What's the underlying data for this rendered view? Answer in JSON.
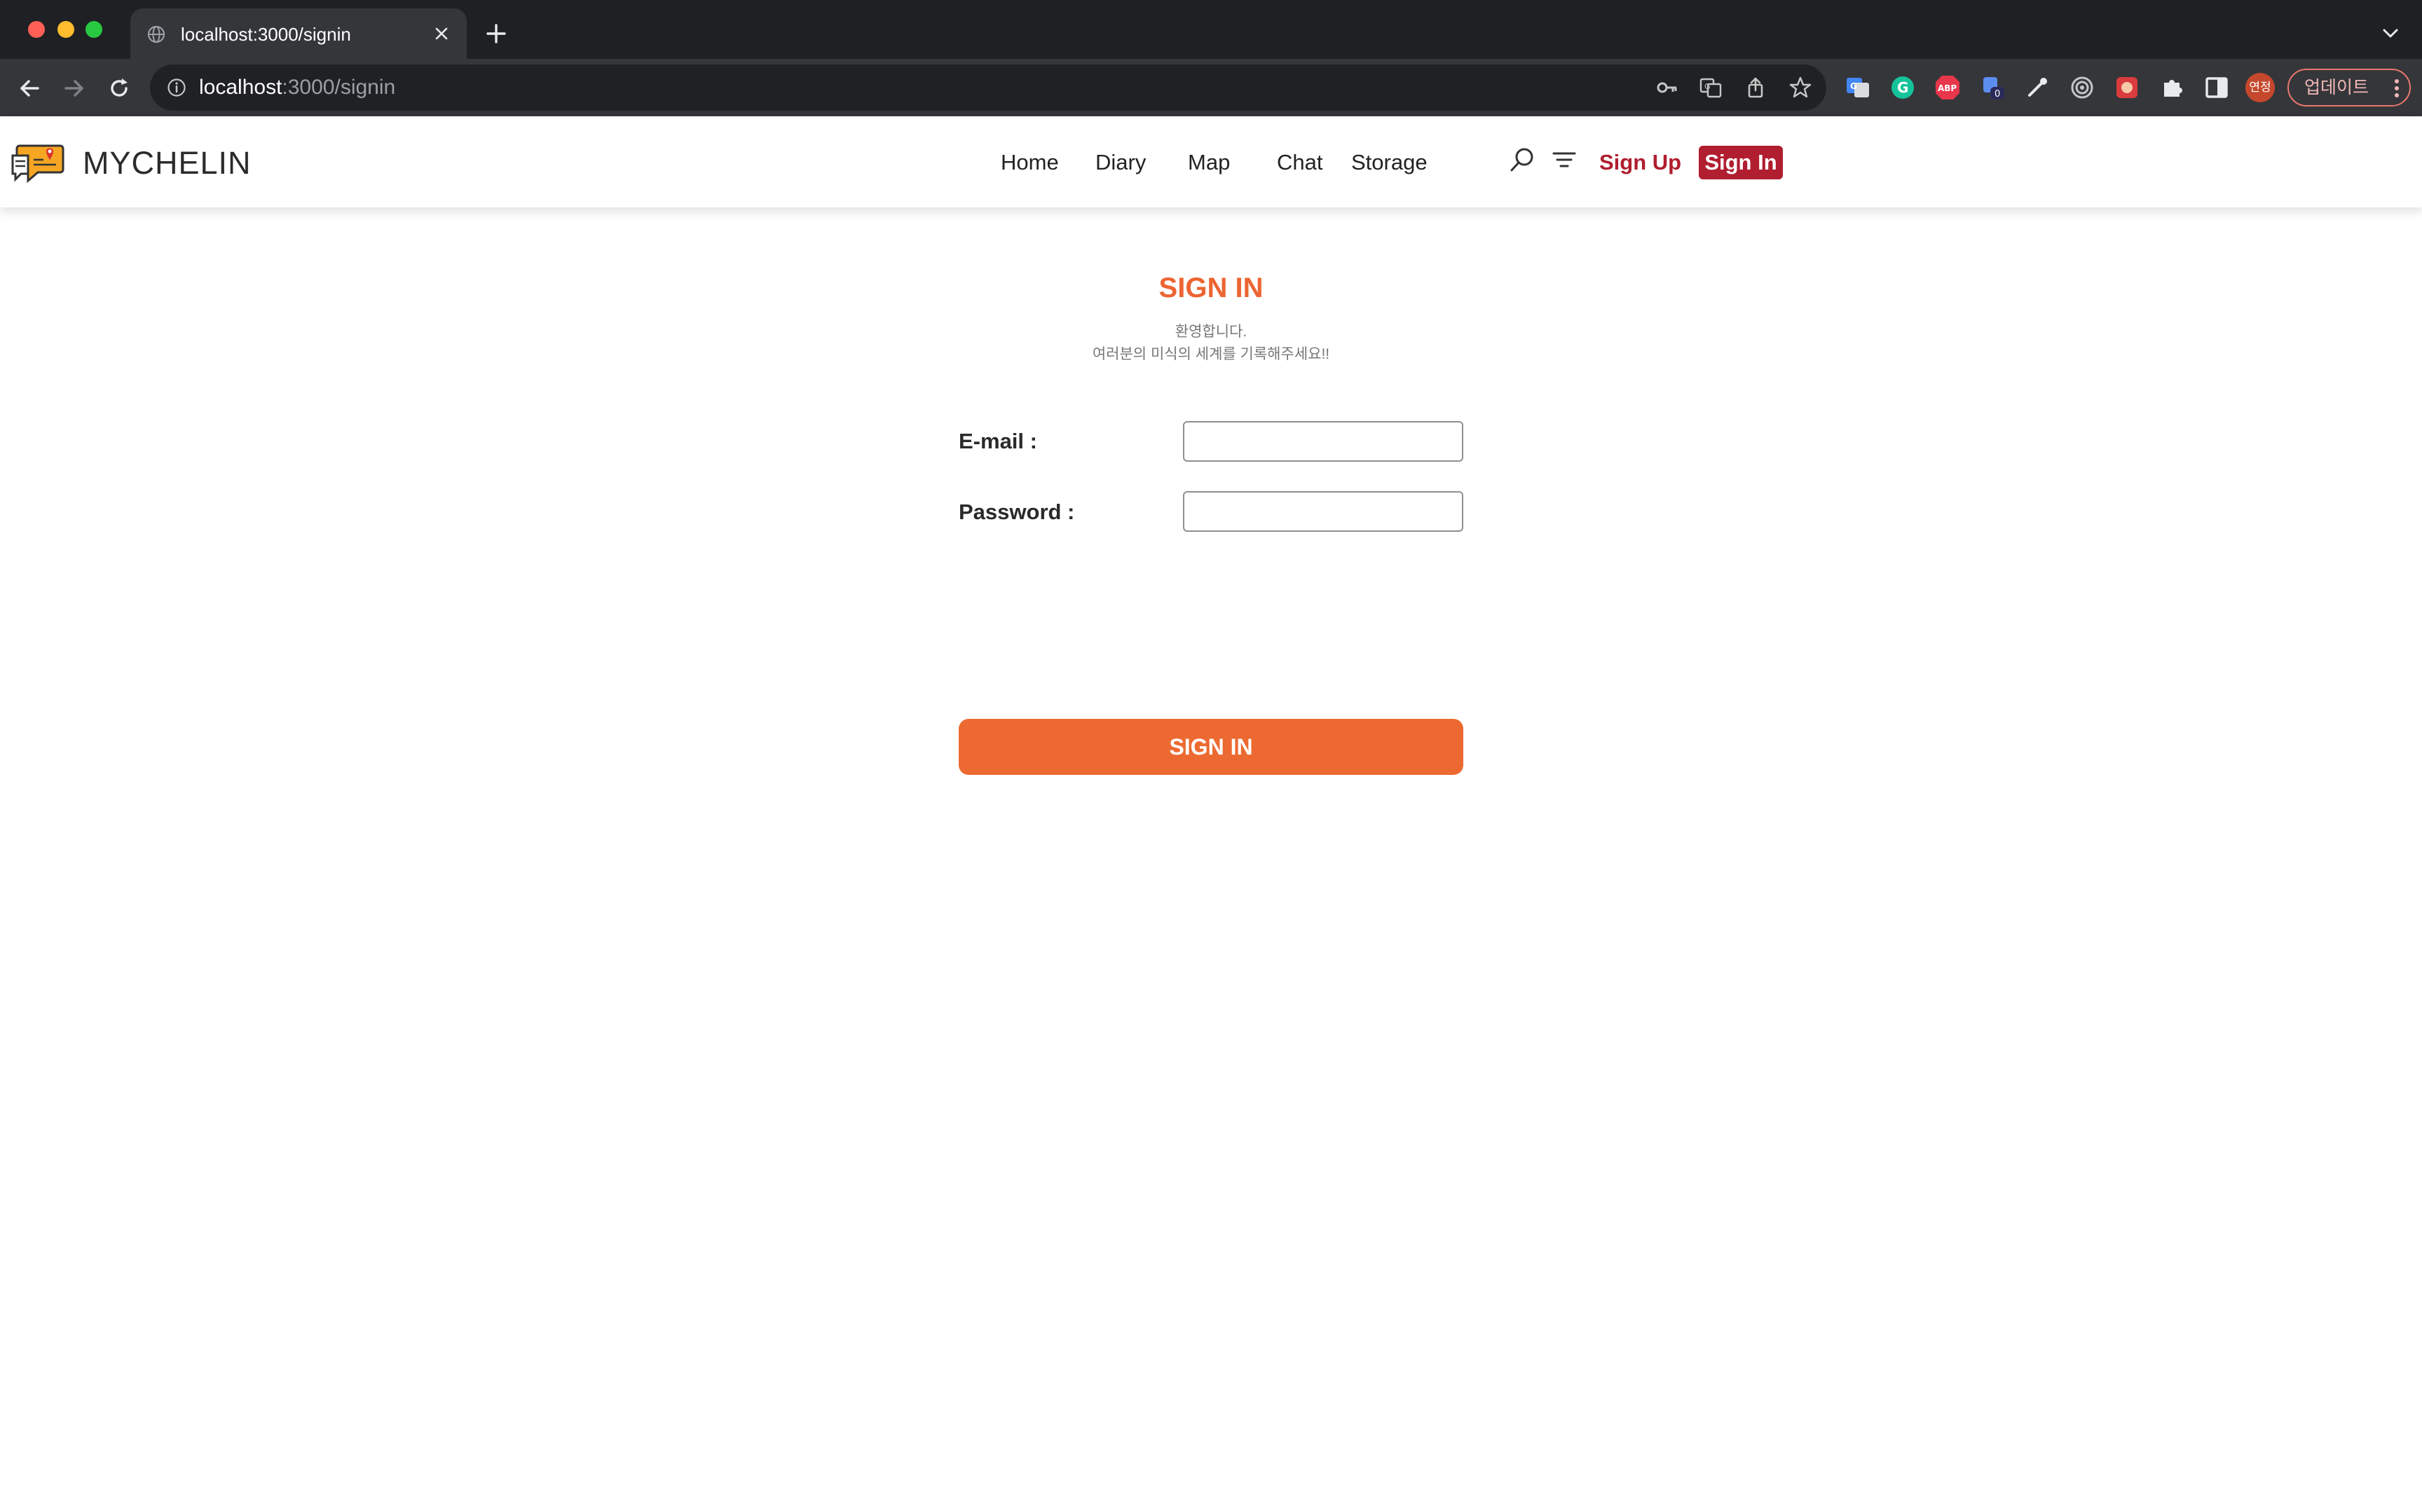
{
  "browser": {
    "tab": {
      "title": "localhost:3000/signin",
      "icon": "globe-icon"
    },
    "address_bar": {
      "host": "localhost",
      "path": ":3000/signin"
    },
    "profile_label": "연정",
    "update_label": "업데이트",
    "extensions": [
      "google-translate-ext-icon",
      "grammarly-icon",
      "adblock-plus-icon",
      "extension-badge-icon",
      "eyedropper-icon",
      "target-ext-icon",
      "red-ext-icon",
      "puzzle-extensions-icon",
      "side-panel-icon"
    ],
    "extension_badge_count": "0",
    "extension_abp_label": "ABP"
  },
  "site": {
    "brand": "MYCHELIN",
    "nav": {
      "home": "Home",
      "diary": "Diary",
      "map": "Map",
      "chat": "Chat",
      "storage": "Storage"
    },
    "auth": {
      "signup": "Sign Up",
      "signin": "Sign In"
    }
  },
  "form": {
    "title": "SIGN IN",
    "welcome_line1": "환영합니다.",
    "welcome_line2": "여러분의 미식의 세계를 기록해주세요!!",
    "email_label": "E-mail :",
    "email_value": "",
    "password_label": "Password :",
    "password_value": "",
    "submit_label": "SIGN IN"
  },
  "colors": {
    "accent_orange": "#ec6a31",
    "brand_red": "#b01e2f",
    "chrome_dark": "#1f2023",
    "toolbar": "#35363a"
  }
}
